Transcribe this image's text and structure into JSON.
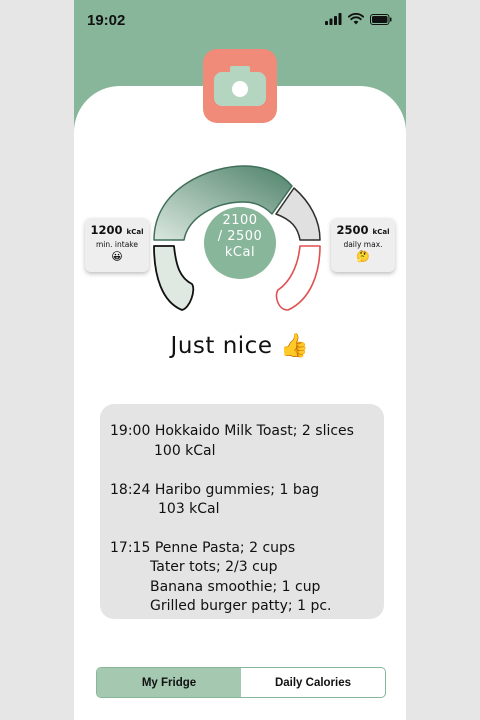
{
  "status_bar": {
    "time": "19:02"
  },
  "camera_button": {
    "icon": "camera-icon"
  },
  "gauge": {
    "current_text": "2100",
    "target_text": "/ 2500",
    "unit_text": "kCal",
    "current": 2100,
    "target": 2500,
    "colors": {
      "left_segment_fill": "#dfe9e1",
      "main_arc_start": "#dbe8df",
      "main_arc_end": "#4e826a",
      "right_upper_fill": "#e0e0e0",
      "right_lower_stroke": "#e05050",
      "center": "#88b69a"
    }
  },
  "min_limit": {
    "value": "1200",
    "unit": "kCal",
    "label": "min. intake",
    "emoji": "😀"
  },
  "max_limit": {
    "value": "2500",
    "unit": "kCal",
    "label": "daily max.",
    "emoji": "🤔"
  },
  "status_message": {
    "text": "Just nice",
    "emoji": "👍"
  },
  "food_log": [
    {
      "time": "19:00",
      "lines": [
        "Hokkaido Milk Toast; 2 slices",
        "100 kCal"
      ]
    },
    {
      "time": "18:24",
      "lines": [
        "Haribo gummies; 1 bag",
        "103 kCal"
      ]
    },
    {
      "time": "17:15",
      "lines": [
        "Penne Pasta; 2 cups",
        "Tater tots; 2/3 cup",
        "Banana smoothie; 1 cup",
        "Grilled burger patty; 1 pc."
      ]
    }
  ],
  "tabs": [
    {
      "label": "My Fridge",
      "active": true
    },
    {
      "label": "Daily Calories",
      "active": false
    }
  ],
  "colors": {
    "brand_green": "#88b69a",
    "accent_coral": "#ef8b78"
  }
}
